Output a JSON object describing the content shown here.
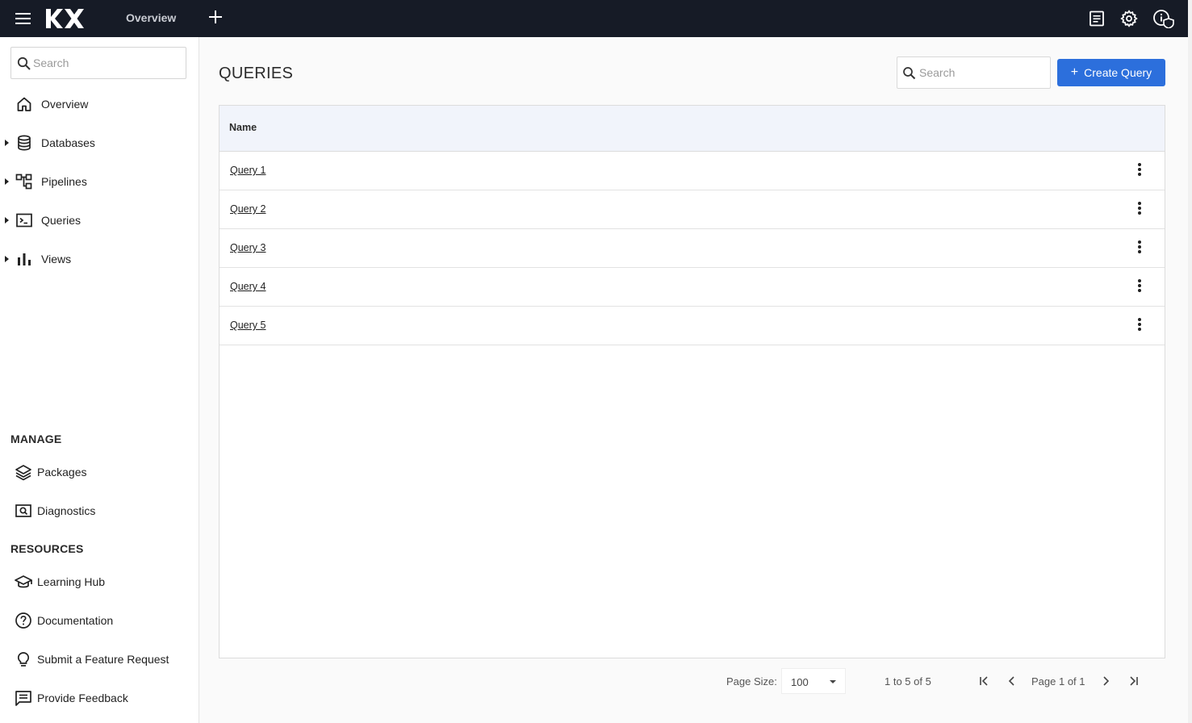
{
  "header": {
    "logo_text": "KX",
    "tab_label": "Overview",
    "icons": [
      "menu-icon",
      "add-icon",
      "notes-icon",
      "settings-icon",
      "info-shield-icon"
    ]
  },
  "sidebar": {
    "search_placeholder": "Search",
    "nav": [
      {
        "label": "Overview",
        "icon": "home-icon",
        "expandable": false
      },
      {
        "label": "Databases",
        "icon": "database-icon",
        "expandable": true
      },
      {
        "label": "Pipelines",
        "icon": "pipeline-icon",
        "expandable": true
      },
      {
        "label": "Queries",
        "icon": "terminal-icon",
        "expandable": true
      },
      {
        "label": "Views",
        "icon": "bar-chart-icon",
        "expandable": true
      }
    ],
    "manage_title": "MANAGE",
    "manage": [
      {
        "label": "Packages",
        "icon": "layers-icon"
      },
      {
        "label": "Diagnostics",
        "icon": "diagnostics-icon"
      }
    ],
    "resources_title": "RESOURCES",
    "resources": [
      {
        "label": "Learning Hub",
        "icon": "school-icon"
      },
      {
        "label": "Documentation",
        "icon": "help-circle-icon"
      },
      {
        "label": "Submit a Feature Request",
        "icon": "lightbulb-icon"
      },
      {
        "label": "Provide Feedback",
        "icon": "feedback-icon"
      }
    ]
  },
  "main": {
    "title": "QUERIES",
    "search_placeholder": "Search",
    "create_label": "Create Query",
    "column_name": "Name",
    "rows": [
      "Query 1",
      "Query 2",
      "Query 3",
      "Query 4",
      "Query 5"
    ],
    "pager": {
      "page_size_label": "Page Size:",
      "page_size": "100",
      "range": "1 to 5 of 5",
      "page_info": "Page 1 of 1"
    }
  },
  "colors": {
    "topbar": "#161b26",
    "accent": "#2c6fdc",
    "grid_header": "#f1f4fb"
  }
}
